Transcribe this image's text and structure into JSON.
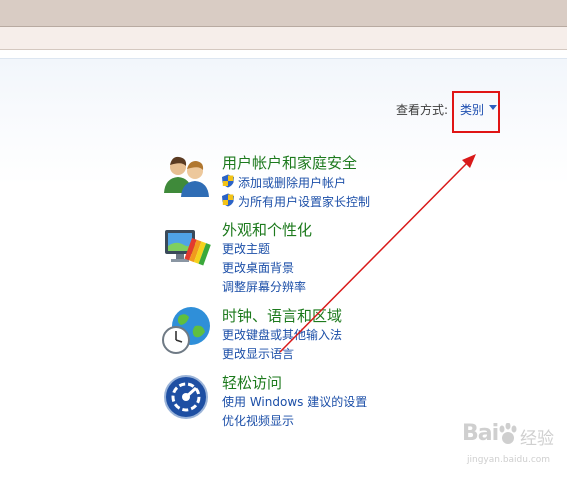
{
  "view": {
    "label": "查看方式:",
    "value": "类别"
  },
  "categories": [
    {
      "title": "用户帐户和家庭安全",
      "icon": "users-icon",
      "links": [
        {
          "text": "添加或删除用户帐户",
          "shield": true
        },
        {
          "text": "为所有用户设置家长控制",
          "shield": true
        }
      ]
    },
    {
      "title": "外观和个性化",
      "icon": "appearance-icon",
      "links": [
        {
          "text": "更改主题"
        },
        {
          "text": "更改桌面背景"
        },
        {
          "text": "调整屏幕分辨率"
        }
      ]
    },
    {
      "title": "时钟、语言和区域",
      "icon": "clock-globe-icon",
      "links": [
        {
          "text": "更改键盘或其他输入法"
        },
        {
          "text": "更改显示语言"
        }
      ]
    },
    {
      "title": "轻松访问",
      "icon": "ease-of-access-icon",
      "links": [
        {
          "text": "使用 Windows 建议的设置"
        },
        {
          "text": "优化视频显示"
        }
      ]
    }
  ],
  "watermark": {
    "logo": "Bai",
    "text": "经验",
    "url": "jingyan.baidu.com"
  },
  "colors": {
    "annotation": "#e01515",
    "category_title": "#1d7a1d",
    "link": "#1c4fa8"
  }
}
